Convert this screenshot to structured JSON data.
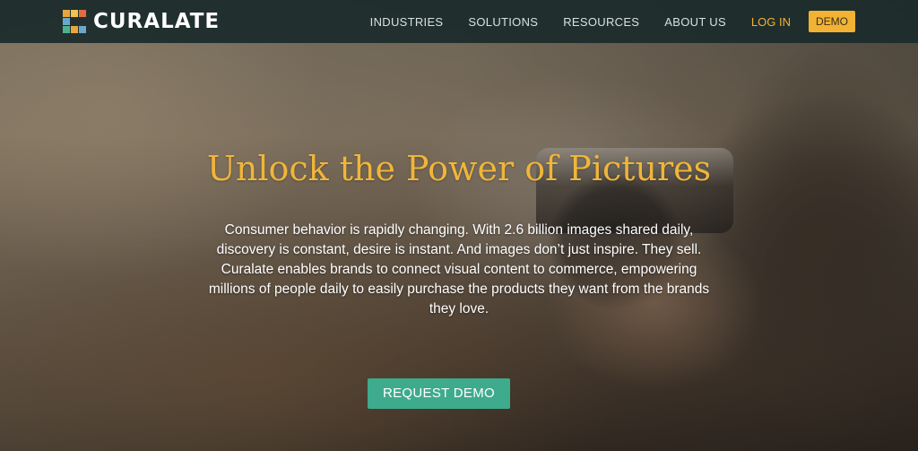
{
  "nav": {
    "brand": "CURALATE",
    "items": [
      "INDUSTRIES",
      "SOLUTIONS",
      "RESOURCES",
      "ABOUT US"
    ],
    "login_label": "LOG IN",
    "demo_label": "DEMO"
  },
  "hero": {
    "title": "Unlock the Power of Pictures",
    "body_lines": [
      "Consumer behavior is rapidly changing. With 2.6 billion images shared daily,",
      "discovery is constant, desire is instant. And images don’t just inspire. They sell.",
      "Curalate enables brands to connect visual content to commerce, empowering",
      "millions of people daily to easily purchase the products they want from the brands",
      "they love."
    ],
    "cta_label": "REQUEST DEMO"
  },
  "colors": {
    "nav_bg": "#1c2c2c",
    "accent_gold": "#f2b233",
    "cta_green": "#3eab8c",
    "logo_colors": [
      "#e8a63a",
      "#6aa7c9",
      "#4fb08d",
      "#e36c3c"
    ]
  },
  "icons": {
    "logo": "curalate-logo-mark"
  }
}
